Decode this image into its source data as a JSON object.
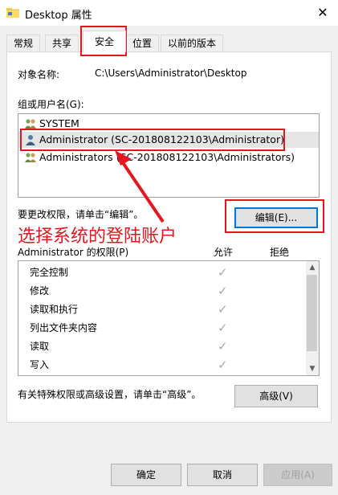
{
  "window": {
    "title": "Desktop 属性",
    "close_glyph": "✕"
  },
  "tabs": [
    {
      "label": "常规"
    },
    {
      "label": "共享"
    },
    {
      "label": "安全"
    },
    {
      "label": "位置"
    },
    {
      "label": "以前的版本"
    }
  ],
  "security": {
    "object_name_label": "对象名称:",
    "object_name_value": "C:\\Users\\Administrator\\Desktop",
    "group_label": "组或用户名(G):",
    "groups": [
      {
        "name": "SYSTEM"
      },
      {
        "name": "Administrator (SC-201808122103\\Administrator)"
      },
      {
        "name": "Administrators (SC-201808122103\\Administrators)"
      }
    ],
    "edit_hint": "要更改权限，请单击“编辑”。",
    "edit_button": "编辑(E)...",
    "perm_label": "Administrator 的权限(P)",
    "allow_header": "允许",
    "deny_header": "拒绝",
    "permissions": [
      {
        "name": "完全控制",
        "allow": "✓"
      },
      {
        "name": "修改",
        "allow": "✓"
      },
      {
        "name": "读取和执行",
        "allow": "✓"
      },
      {
        "name": "列出文件夹内容",
        "allow": "✓"
      },
      {
        "name": "读取",
        "allow": "✓"
      },
      {
        "name": "写入",
        "allow": "✓"
      }
    ],
    "advanced_hint": "有关特殊权限或高级设置，请单击“高级”。",
    "advanced_button": "高级(V)",
    "scroll_up": "▲",
    "scroll_down": "▼"
  },
  "footer": {
    "ok": "确定",
    "cancel": "取消",
    "apply": "应用(A)"
  },
  "annotation": {
    "text": "选择系统的登陆账户",
    "color": "#e5161d"
  }
}
